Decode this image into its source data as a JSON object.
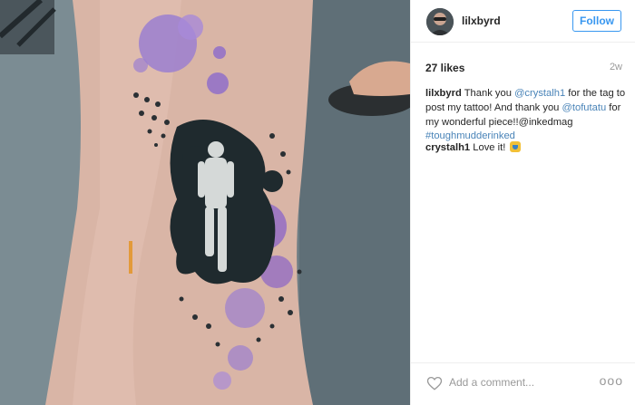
{
  "photo": {
    "alt_subject": "tattoo-photo"
  },
  "header": {
    "username": "lilxbyrd",
    "follow_label": "Follow"
  },
  "stats": {
    "likes": "27 likes",
    "age": "2w"
  },
  "caption": {
    "author": "lilxbyrd",
    "t1": " Thank you ",
    "mention1": "@crystalh1",
    "t2": " for the tag to post my tattoo! And thank you ",
    "mention2": "@tofutatu",
    "t3": " for my wonderful piece!!@inkedmag ",
    "hashtag": "#toughmudderinked"
  },
  "comment": {
    "author": "crystalh1",
    "text": " Love it! "
  },
  "footer": {
    "add_comment_placeholder": "Add a comment...",
    "more_label": "ooo"
  },
  "colors": {
    "follow_blue": "#3897f0",
    "link_blue": "#4a84b8",
    "ink_purple": "#9b6fd0",
    "ink_dark": "#1f2a2e"
  },
  "icons": [
    "heart-icon",
    "more-options-icon",
    "emoji-icon"
  ]
}
